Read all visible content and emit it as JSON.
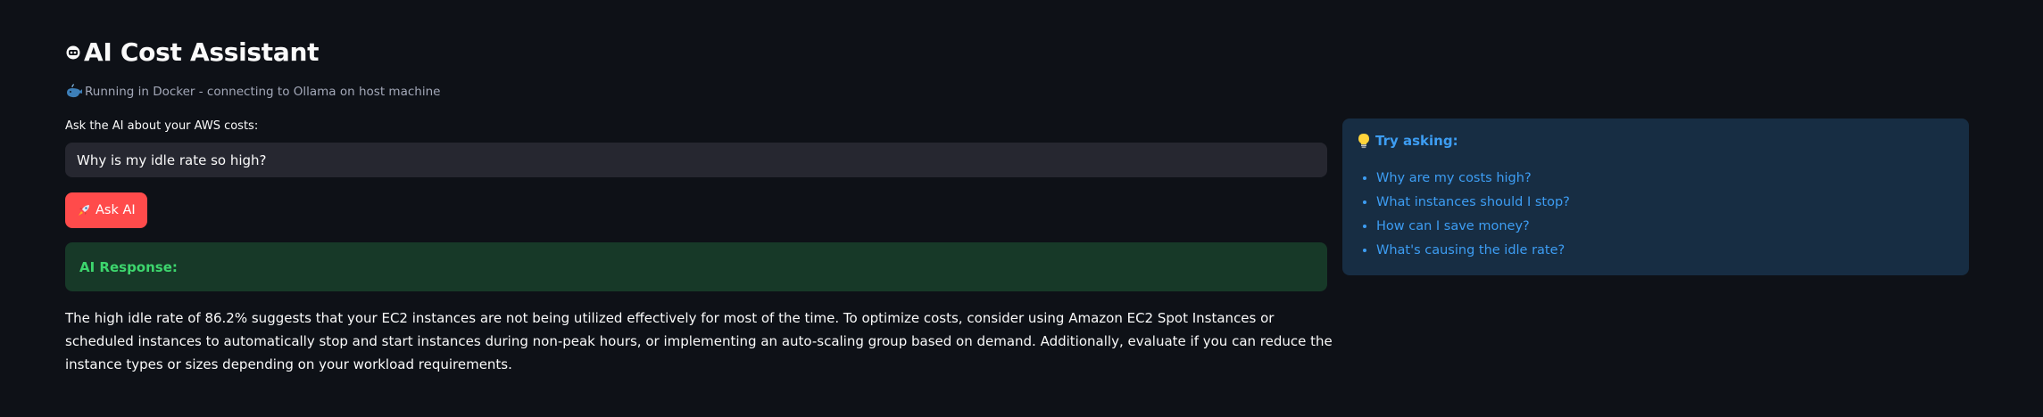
{
  "header": {
    "title": "AI Cost Assistant",
    "title_icon": "robot-face-icon",
    "caption": "Running in Docker - connecting to Ollama on host machine",
    "caption_icon": "whale-icon"
  },
  "query": {
    "label": "Ask the AI about your AWS costs:",
    "value": "Why is my idle rate so high?"
  },
  "ask_button": {
    "label": "Ask AI",
    "icon": "rocket-icon",
    "color": "#ff4b4b"
  },
  "response": {
    "label": "AI Response:",
    "text": "The high idle rate of 86.2% suggests that your EC2 instances are not being utilized effectively for most of the time. To optimize costs, consider using Amazon EC2 Spot Instances or scheduled instances to automatically stop and start instances during non-peak hours, or implementing an auto-scaling group based on demand. Additionally, evaluate if you can reduce the instance types or sizes depending on your workload requirements.",
    "box_color": "#173928",
    "label_color": "#3dd56d"
  },
  "suggestions": {
    "heading": "Try asking:",
    "icon": "lightbulb-icon",
    "items": [
      "Why are my costs high?",
      "What instances should I stop?",
      "How can I save money?",
      "What's causing the idle rate?"
    ],
    "box_color": "#172d43",
    "text_color": "#3d9df3"
  },
  "theme": {
    "background": "#0e1117",
    "input_background": "#262730"
  }
}
